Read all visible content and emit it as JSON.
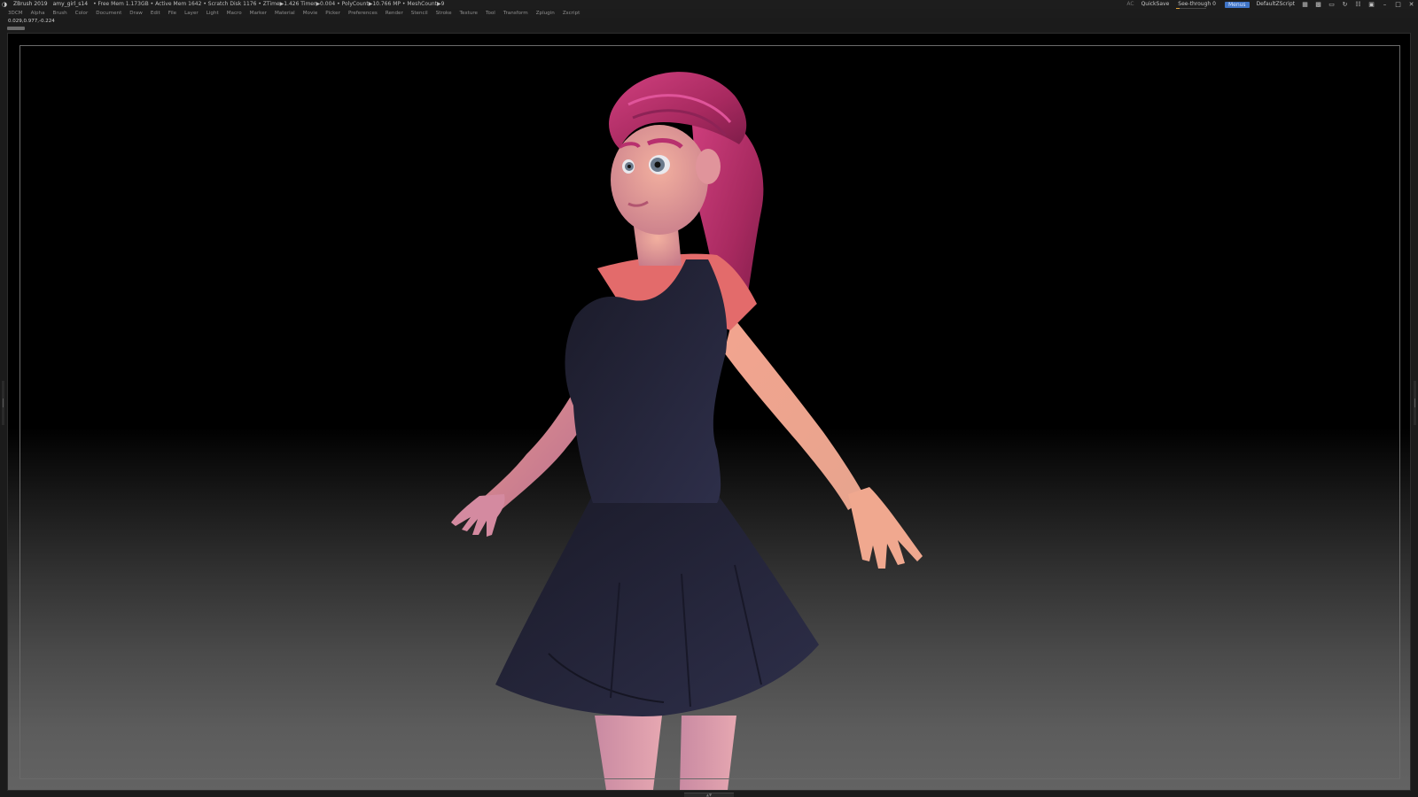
{
  "titlebar": {
    "app_name": "ZBrush 2019",
    "document": "amy_girl_s14",
    "stats": "• Free Mem 1.173GB • Active Mem 1642 • Scratch Disk 1176 • ZTime▶1.426 Timer▶0.004 • PolyCount▶10.766 MP • MeshCount▶9",
    "ac": "AC",
    "quicksave": "QuickSave",
    "see_through_label": "See-through",
    "see_through_value": "0",
    "see_through_fraction": 0.0,
    "menus_label": "Menus",
    "script_label": "DefaultZScript",
    "accent_color": "#3f74c6",
    "slider_color": "#e3a33a",
    "window_icons": [
      "minimize-icon",
      "maximize-icon",
      "close-icon"
    ]
  },
  "menubar": {
    "items": [
      "3DCM",
      "Alpha",
      "Brush",
      "Color",
      "Document",
      "Draw",
      "Edit",
      "File",
      "Layer",
      "Light",
      "Macro",
      "Marker",
      "Material",
      "Movie",
      "Picker",
      "Preferences",
      "Render",
      "Stencil",
      "Stroke",
      "Texture",
      "Tool",
      "Transform",
      "Zplugin",
      "Zscript"
    ]
  },
  "status": {
    "coordinates": "0.029,0.977,-0.224"
  },
  "viewport": {
    "subject": "3d-character-model",
    "background_top": "#000000",
    "background_bottom": "#636363",
    "colors": {
      "hair": "#b8306e",
      "skin": "#e8a09a",
      "shirt": "#e36b6b",
      "dress": "#222338"
    }
  }
}
